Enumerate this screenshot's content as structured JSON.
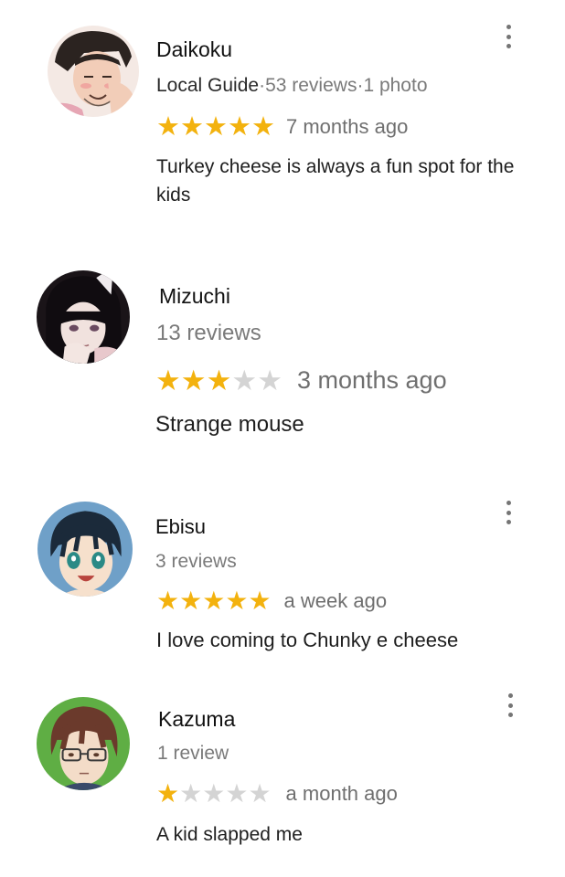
{
  "reviews": [
    {
      "name": "Daikoku",
      "local_guide": "Local Guide",
      "meta": "·53 reviews·1 photo",
      "rating": 5,
      "ago": "7 months ago",
      "text": "Turkey cheese is always a fun spot for the kids",
      "avatar_icon": "avatar-daikoku",
      "has_menu": true
    },
    {
      "name": "Mizuchi",
      "local_guide": "",
      "meta": "13 reviews",
      "rating": 3,
      "ago": "3 months ago",
      "text": "Strange mouse",
      "avatar_icon": "avatar-mizuchi",
      "has_menu": false
    },
    {
      "name": "Ebisu",
      "local_guide": "",
      "meta": "3 reviews",
      "rating": 5,
      "ago": "a week ago",
      "text": "I love coming to Chunky e cheese",
      "avatar_icon": "avatar-ebisu",
      "has_menu": true
    },
    {
      "name": "Kazuma",
      "local_guide": "",
      "meta": "1 review",
      "rating": 1,
      "ago": "a month ago",
      "text": "A kid slapped me",
      "avatar_icon": "avatar-kazuma",
      "has_menu": true
    }
  ],
  "colors": {
    "star_on": "#f3b20e",
    "star_off": "#d4d4d4",
    "meta_text": "#7a7a7a"
  }
}
